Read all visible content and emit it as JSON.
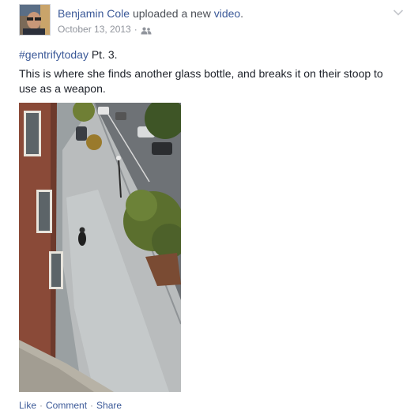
{
  "post": {
    "author": "Benjamin Cole",
    "action_text": " uploaded a new ",
    "object_text": "video",
    "action_end": ".",
    "timestamp": "October 13, 2013",
    "separator": "·",
    "audience_icon": "friends-icon",
    "options_icon": "chevron-down-icon",
    "hashtag": "#gentrifytoday",
    "hashtag_suffix": " Pt. 3.",
    "body": "This is where she finds another glass bottle, and breaks it on their stoop to use as a weapon."
  },
  "actions": {
    "like": "Like",
    "comment": "Comment",
    "share": "Share",
    "dot": "·"
  },
  "colors": {
    "link": "#3b5998",
    "text": "#1d2129",
    "meta": "#90949c"
  }
}
